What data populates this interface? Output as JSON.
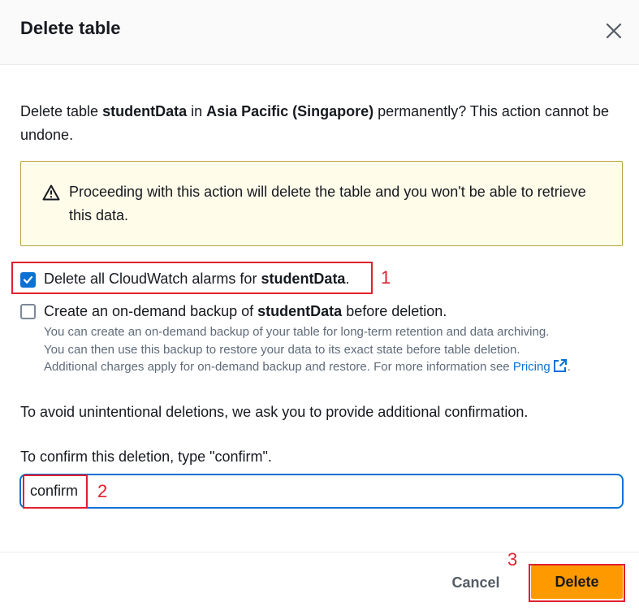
{
  "header": {
    "title": "Delete table"
  },
  "description": {
    "prefix": "Delete table ",
    "table_name": "studentData",
    "middle": " in ",
    "region": "Asia Pacific (Singapore)",
    "suffix": " permanently? This action cannot be undone."
  },
  "warning": {
    "text": "Proceeding with this action will delete the table and you won't be able to retrieve this data."
  },
  "options": {
    "alarms": {
      "checked": true,
      "prefix": "Delete all CloudWatch alarms for ",
      "table_name": "studentData",
      "suffix": "."
    },
    "backup": {
      "checked": false,
      "prefix": "Create an on-demand backup of ",
      "table_name": "studentData",
      "suffix": " before deletion.",
      "desc_1": "You can create an on-demand backup of your table for long-term retention and data archiving.",
      "desc_2": "You can then use this backup to restore your data to its exact state before table deletion.",
      "desc_3": "Additional charges apply for on-demand backup and restore. For more information see ",
      "link": "Pricing",
      "desc_end": "."
    }
  },
  "confirmation": {
    "avoid_text": "To avoid unintentional deletions, we ask you to provide additional confirmation.",
    "label": "To confirm this deletion, type \"confirm\".",
    "value": "confirm"
  },
  "footer": {
    "cancel_label": "Cancel",
    "delete_label": "Delete"
  },
  "annotations": [
    "1",
    "2",
    "3"
  ],
  "colors": {
    "primary_button": "#ff9900",
    "link": "#0972d3",
    "annotation": "#e0202e",
    "warning_bg": "#fffce9"
  }
}
